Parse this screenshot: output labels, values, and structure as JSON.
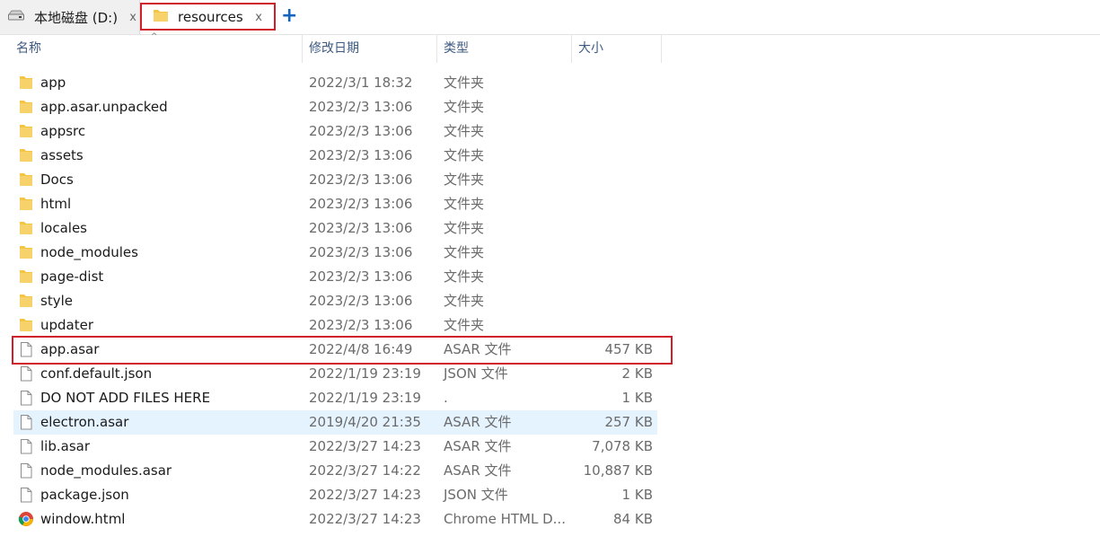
{
  "tabs": [
    {
      "label": "本地磁盘 (D:)",
      "close": "x",
      "icon": "drive-icon"
    },
    {
      "label": "resources",
      "close": "x",
      "icon": "folder-icon"
    }
  ],
  "new_tab_label": "+",
  "sort_indicator": "^",
  "columns": {
    "name": "名称",
    "date": "修改日期",
    "type": "类型",
    "size": "大小"
  },
  "colors": {
    "folder": "#f4c542",
    "highlight_border": "#d01f2b",
    "hover_row": "#e5f3ff",
    "header_text": "#3d5a82",
    "accent_blue": "#1565c0"
  },
  "files": [
    {
      "name": "app",
      "date": "2022/3/1 18:32",
      "type": "文件夹",
      "size": "",
      "icon": "folder-icon"
    },
    {
      "name": "app.asar.unpacked",
      "date": "2023/2/3 13:06",
      "type": "文件夹",
      "size": "",
      "icon": "folder-icon"
    },
    {
      "name": "appsrc",
      "date": "2023/2/3 13:06",
      "type": "文件夹",
      "size": "",
      "icon": "folder-icon"
    },
    {
      "name": "assets",
      "date": "2023/2/3 13:06",
      "type": "文件夹",
      "size": "",
      "icon": "folder-icon"
    },
    {
      "name": "Docs",
      "date": "2023/2/3 13:06",
      "type": "文件夹",
      "size": "",
      "icon": "folder-icon"
    },
    {
      "name": "html",
      "date": "2023/2/3 13:06",
      "type": "文件夹",
      "size": "",
      "icon": "folder-icon"
    },
    {
      "name": "locales",
      "date": "2023/2/3 13:06",
      "type": "文件夹",
      "size": "",
      "icon": "folder-icon"
    },
    {
      "name": "node_modules",
      "date": "2023/2/3 13:06",
      "type": "文件夹",
      "size": "",
      "icon": "folder-icon"
    },
    {
      "name": "page-dist",
      "date": "2023/2/3 13:06",
      "type": "文件夹",
      "size": "",
      "icon": "folder-icon"
    },
    {
      "name": "style",
      "date": "2023/2/3 13:06",
      "type": "文件夹",
      "size": "",
      "icon": "folder-icon"
    },
    {
      "name": "updater",
      "date": "2023/2/3 13:06",
      "type": "文件夹",
      "size": "",
      "icon": "folder-icon"
    },
    {
      "name": "app.asar",
      "date": "2022/4/8 16:49",
      "type": "ASAR 文件",
      "size": "457 KB",
      "icon": "file-icon"
    },
    {
      "name": "conf.default.json",
      "date": "2022/1/19 23:19",
      "type": "JSON 文件",
      "size": "2 KB",
      "icon": "file-icon"
    },
    {
      "name": "DO NOT ADD FILES HERE",
      "date": "2022/1/19 23:19",
      "type": ".",
      "size": "1 KB",
      "icon": "file-icon"
    },
    {
      "name": "electron.asar",
      "date": "2019/4/20 21:35",
      "type": "ASAR 文件",
      "size": "257 KB",
      "icon": "file-icon"
    },
    {
      "name": "lib.asar",
      "date": "2022/3/27 14:23",
      "type": "ASAR 文件",
      "size": "7,078 KB",
      "icon": "file-icon"
    },
    {
      "name": "node_modules.asar",
      "date": "2022/3/27 14:22",
      "type": "ASAR 文件",
      "size": "10,887 KB",
      "icon": "file-icon"
    },
    {
      "name": "package.json",
      "date": "2022/3/27 14:23",
      "type": "JSON 文件",
      "size": "1 KB",
      "icon": "file-icon"
    },
    {
      "name": "window.html",
      "date": "2022/3/27 14:23",
      "type": "Chrome HTML D...",
      "size": "84 KB",
      "icon": "chrome-icon"
    }
  ]
}
